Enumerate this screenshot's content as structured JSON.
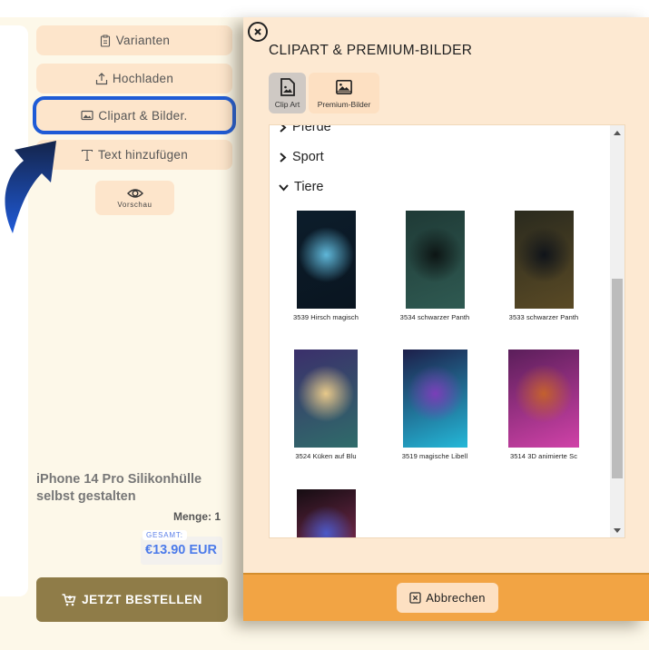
{
  "sidebar": {
    "buttons": [
      {
        "label": "Varianten",
        "icon": "clipboard-icon"
      },
      {
        "label": "Hochladen",
        "icon": "upload-icon"
      },
      {
        "label": "Clipart & Bilder.",
        "icon": "image-icon",
        "highlighted": true
      },
      {
        "label": "Text hinzufügen",
        "icon": "text-icon"
      }
    ],
    "preview_label": "Vorschau"
  },
  "product": {
    "title": "iPhone 14 Pro Silikonhülle selbst gestalten",
    "quantity_label": "Menge: 1",
    "total_label": "GESAMT:",
    "price": "€13.90 EUR",
    "order_button": "JETZT BESTELLEN"
  },
  "modal": {
    "title": "CLIPART & PREMIUM-BILDER",
    "tabs": [
      {
        "label": "Clip Art",
        "active": true
      },
      {
        "label": "Premium-Bilder",
        "active": false
      }
    ],
    "categories": [
      {
        "label": "Pferde",
        "expanded": false
      },
      {
        "label": "Sport",
        "expanded": false
      },
      {
        "label": "Tiere",
        "expanded": true
      }
    ],
    "images": [
      {
        "caption": "3539 Hirsch magisch",
        "colors": [
          "#0c1d2b",
          "#5fb7d9",
          "#0a1520"
        ]
      },
      {
        "caption": "3534 schwarzer Panth",
        "colors": [
          "#1f3a36",
          "#0d1514",
          "#2f5a52"
        ]
      },
      {
        "caption": "3533 schwarzer Panth",
        "colors": [
          "#2a2a1e",
          "#10141a",
          "#5a4a25"
        ]
      },
      {
        "caption": "3524 Küken auf Blu",
        "colors": [
          "#3b2f6b",
          "#e8c98a",
          "#2f6c6a"
        ]
      },
      {
        "caption": "3519 magische Libell",
        "colors": [
          "#1d1f4a",
          "#7a3fb8",
          "#24b8d8"
        ]
      },
      {
        "caption": "3514 3D animierte Sc",
        "colors": [
          "#5a1e5a",
          "#c3602e",
          "#d042a8"
        ]
      },
      {
        "caption": "",
        "colors": [
          "#150d12",
          "#4b59c8",
          "#a8386a"
        ]
      }
    ],
    "scroll_position": 0.45,
    "cancel_button": "Abbrechen"
  }
}
